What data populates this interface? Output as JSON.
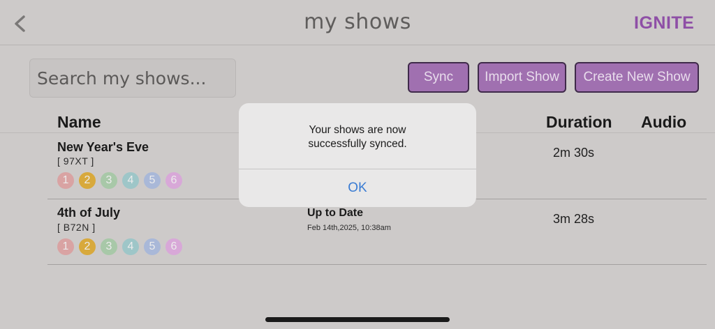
{
  "header": {
    "title": "my shows",
    "logo_text": "IGNITE",
    "back_icon": "chevron-left-icon"
  },
  "search": {
    "placeholder": "Search my shows..."
  },
  "toolbar": {
    "sync_label": "Sync",
    "import_label": "Import Show",
    "create_label": "Create New Show"
  },
  "columns": {
    "name": "Name",
    "duration": "Duration",
    "audio": "Audio"
  },
  "shows": [
    {
      "name": "New Year's Eve",
      "code": "[ 97XT ]",
      "status": "",
      "time": "",
      "duration": "2m 30s",
      "badges": [
        "1",
        "2",
        "3",
        "4",
        "5",
        "6"
      ]
    },
    {
      "name": "4th of July",
      "code": "[ B72N ]",
      "status": "Up to Date",
      "time": "Feb 14th,2025, 10:38am",
      "duration": "3m 28s",
      "badges": [
        "1",
        "2",
        "3",
        "4",
        "5",
        "6"
      ]
    }
  ],
  "badge_colors": [
    "#d9a3a3",
    "#d8a93c",
    "#a8c8a8",
    "#9ec6c8",
    "#a9b8d8",
    "#d8a8d8"
  ],
  "dialog": {
    "message_line1": "Your shows are now",
    "message_line2": "successfully synced.",
    "ok_label": "OK"
  }
}
